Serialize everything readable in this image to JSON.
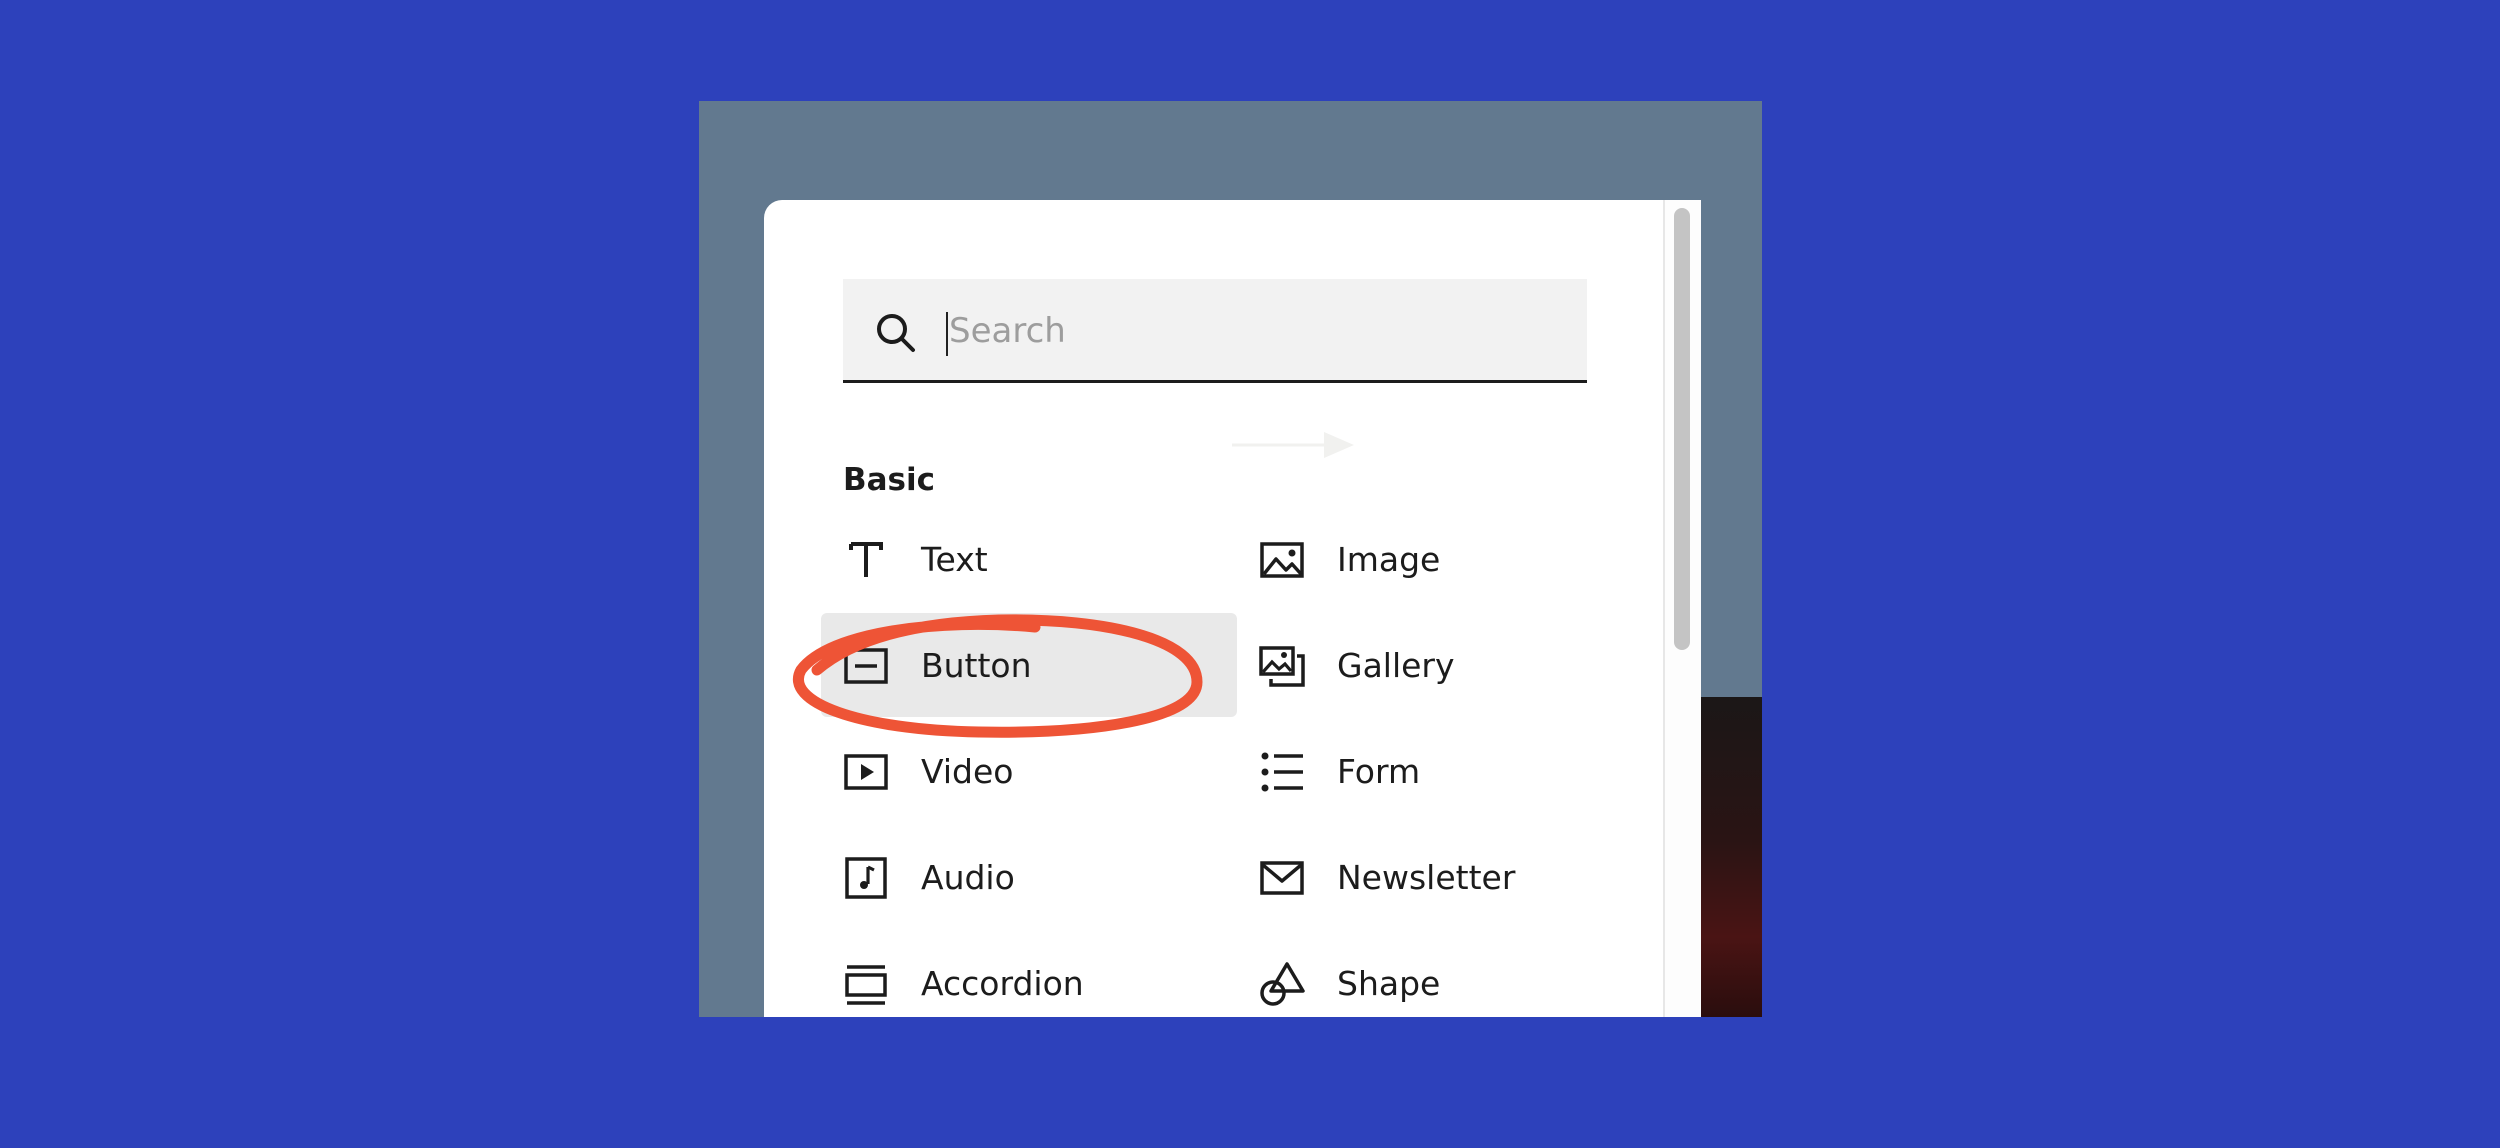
{
  "search": {
    "placeholder": "Search",
    "value": ""
  },
  "section": {
    "title": "Basic"
  },
  "blocks": [
    {
      "label": "Text",
      "icon": "text-icon"
    },
    {
      "label": "Image",
      "icon": "image-icon"
    },
    {
      "label": "Button",
      "icon": "button-icon",
      "selected": true
    },
    {
      "label": "Gallery",
      "icon": "gallery-icon"
    },
    {
      "label": "Video",
      "icon": "video-icon"
    },
    {
      "label": "Form",
      "icon": "form-icon"
    },
    {
      "label": "Audio",
      "icon": "audio-icon"
    },
    {
      "label": "Newsletter",
      "icon": "newsletter-icon"
    },
    {
      "label": "Accordion",
      "icon": "accordion-icon"
    },
    {
      "label": "Shape",
      "icon": "shape-icon"
    }
  ],
  "colors": {
    "background": "#2d41bb",
    "stage": "#62798f",
    "highlight_ring": "#ee5436",
    "selected_tile": "#e9e9e9"
  }
}
